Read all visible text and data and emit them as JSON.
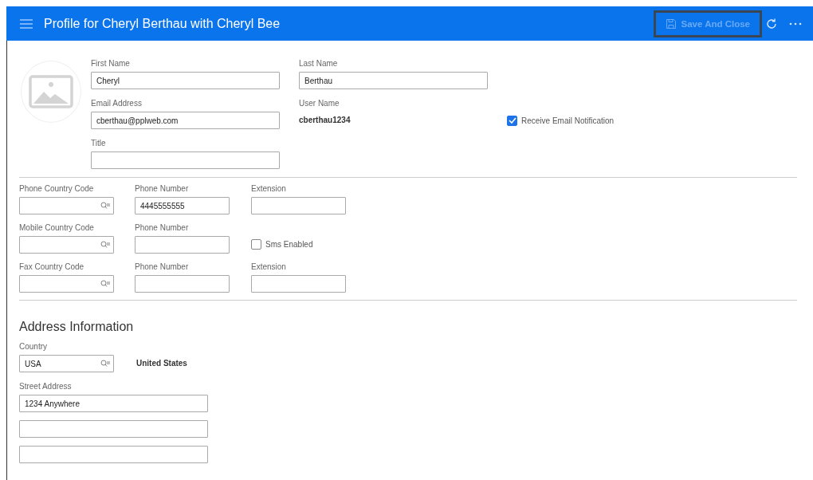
{
  "header": {
    "title": "Profile for Cheryl Berthau with Cheryl Bee",
    "save_button": {
      "label": "Save And Close",
      "disabled": true
    }
  },
  "profile": {
    "first_name": {
      "label": "First Name",
      "value": "Cheryl"
    },
    "last_name": {
      "label": "Last Name",
      "value": "Berthau"
    },
    "email": {
      "label": "Email Address",
      "value": "cberthau@pplweb.com"
    },
    "user_name": {
      "label": "User Name",
      "value": "cberthau1234"
    },
    "receive_email_notification": {
      "label": "Receive Email Notification",
      "checked": true
    },
    "title": {
      "label": "Title"
    }
  },
  "phones": [
    {
      "code_label": "Phone Country Code",
      "number_label": "Phone Number",
      "number": "4445555555",
      "extra": {
        "kind": "extension",
        "label": "Extension"
      }
    },
    {
      "code_label": "Mobile Country Code",
      "number_label": "Phone Number",
      "extra": {
        "kind": "checkbox",
        "label": "Sms Enabled",
        "checked": false
      }
    },
    {
      "code_label": "Fax Country Code",
      "number_label": "Phone Number",
      "extra": {
        "kind": "extension",
        "label": "Extension"
      }
    }
  ],
  "address": {
    "heading": "Address Information",
    "country": {
      "label": "Country",
      "value": "USA",
      "name": "United States"
    },
    "street": {
      "label": "Street Address",
      "lines": [
        {
          "kind": "filled",
          "value": "1234 Anywhere"
        },
        {
          "kind": "blank"
        },
        {
          "kind": "blank"
        }
      ]
    }
  }
}
